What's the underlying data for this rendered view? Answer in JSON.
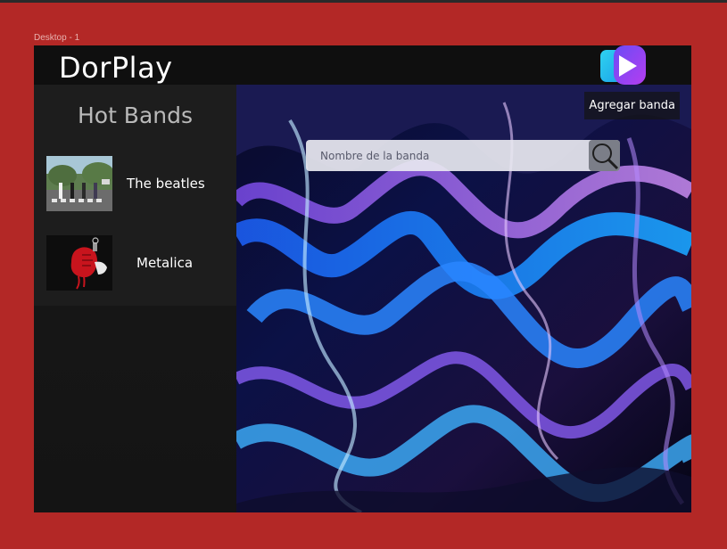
{
  "canvas": {
    "frame_label": "Desktop - 1"
  },
  "header": {
    "title": "DorPlay",
    "logo_icon": "play-logo-icon"
  },
  "sidebar": {
    "title": "Hot Bands",
    "bands": [
      {
        "name": "The beatles",
        "thumb_icon": "album-cover-abbey-road"
      },
      {
        "name": "Metalica",
        "thumb_icon": "album-cover-american-idiot"
      }
    ]
  },
  "main": {
    "add_button_label": "Agregar banda",
    "search": {
      "placeholder": "Nombre de la banda",
      "value": "",
      "button_icon": "search-icon"
    }
  },
  "colors": {
    "canvas": "#b32826",
    "header": "#0f0f0f",
    "sidebar": "#1d1d1d",
    "accent_cyan": "#2fd2f0",
    "accent_purple": "#8a3cf0"
  }
}
